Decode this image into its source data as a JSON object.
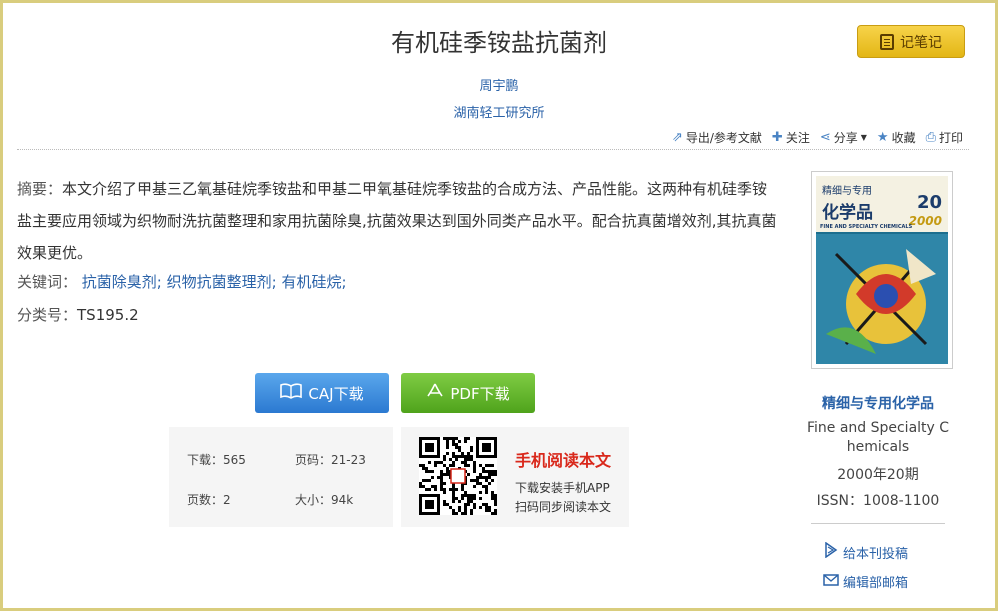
{
  "title": "有机硅季铵盐抗菌剂",
  "note_button": "记笔记",
  "author": "周宇鹏",
  "institution": "湖南轻工研究所",
  "toolbar": {
    "export": "导出/参考文献",
    "follow": "关注",
    "share": "分享",
    "collect": "收藏",
    "print": "打印"
  },
  "abstract": {
    "label": "摘要：",
    "text": "本文介绍了甲基三乙氧基硅烷季铵盐和甲基二甲氧基硅烷季铵盐的合成方法、产品性能。这两种有机硅季铵盐主要应用领域为织物耐洗抗菌整理和家用抗菌除臭,抗菌效果达到国外同类产品水平。配合抗真菌增效剂,其抗真菌效果更优。"
  },
  "keywords": {
    "label": "关键词：",
    "items": [
      "抗菌除臭剂;",
      "织物抗菌整理剂;",
      "有机硅烷;"
    ]
  },
  "classification": {
    "label": "分类号：",
    "value": "TS195.2"
  },
  "downloads": {
    "caj": "CAJ下载",
    "pdf": "PDF下载"
  },
  "stats": {
    "downloads_label": "下载：",
    "downloads_value": "565",
    "pages_label": "页码：",
    "pages_value": "21-23",
    "page_count_label": "页数：",
    "page_count_value": "2",
    "size_label": "大小：",
    "size_value": "94k"
  },
  "mobile": {
    "title": "手机阅读本文",
    "line1": "下载安装手机APP",
    "line2": "扫码同步阅读本文"
  },
  "journal": {
    "cover_title_top": "精细与专用",
    "cover_title": "化学品",
    "cover_issue": "20",
    "cover_year": "2000",
    "cover_en": "FINE AND SPECIALTY CHEMICALS",
    "name": "精细与专用化学品",
    "name_en_line1": "Fine and Specialty C",
    "name_en_line2": "hemicals",
    "issue": "2000年20期",
    "issn": "ISSN：1008-1100",
    "submit": "给本刊投稿",
    "email": "编辑部邮箱"
  }
}
